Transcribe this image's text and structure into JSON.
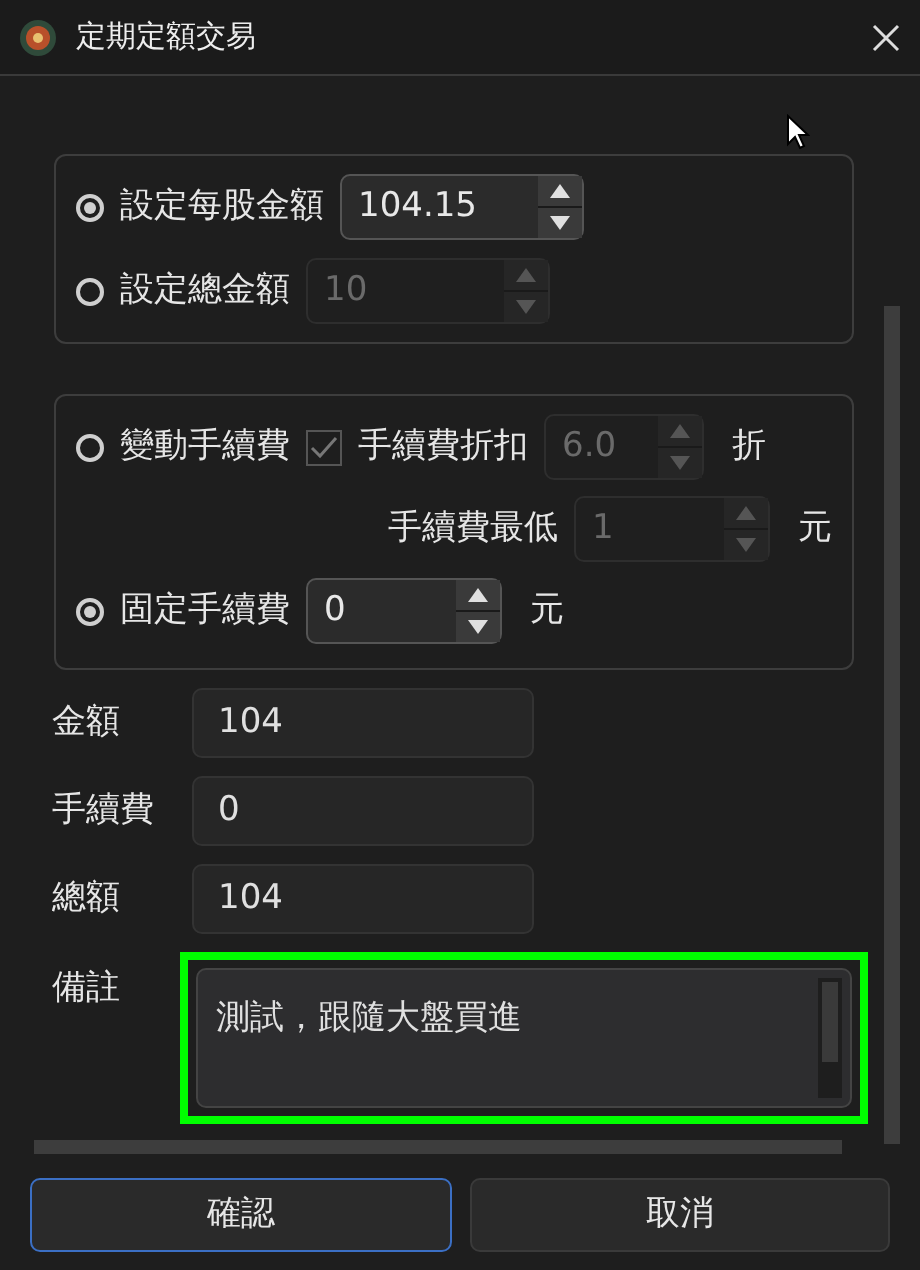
{
  "window": {
    "title": "定期定額交易"
  },
  "amount_mode": [
    {
      "label": "設定每股金額",
      "selected": true,
      "spinner": {
        "value": "104.15",
        "disabled": false
      }
    },
    {
      "label": "設定總金額",
      "selected": false,
      "spinner": {
        "value": "10",
        "disabled": true
      }
    }
  ],
  "fee_mode": {
    "variable": {
      "label": "變動手續費",
      "selected": false,
      "discount": {
        "label": "手續費折扣",
        "checked": true,
        "disabled": true,
        "spinner": {
          "value": "6.0",
          "disabled": true
        },
        "unit": "折"
      },
      "minimum": {
        "label": "手續費最低",
        "spinner": {
          "value": "1",
          "disabled": true
        },
        "unit": "元"
      }
    },
    "fixed": {
      "label": "固定手續費",
      "selected": true,
      "spinner": {
        "value": "0",
        "disabled": false
      },
      "unit": "元"
    }
  },
  "summary": [
    {
      "label": "金額",
      "value": "104"
    },
    {
      "label": "手續費",
      "value": "0"
    },
    {
      "label": "總額",
      "value": "104"
    }
  ],
  "remarks": {
    "label": "備註",
    "value": "測試，跟隨大盤買進",
    "highlighted": true
  },
  "buttons": [
    {
      "label": "確認",
      "kind": "primary"
    },
    {
      "label": "取消",
      "kind": "secondary"
    }
  ]
}
